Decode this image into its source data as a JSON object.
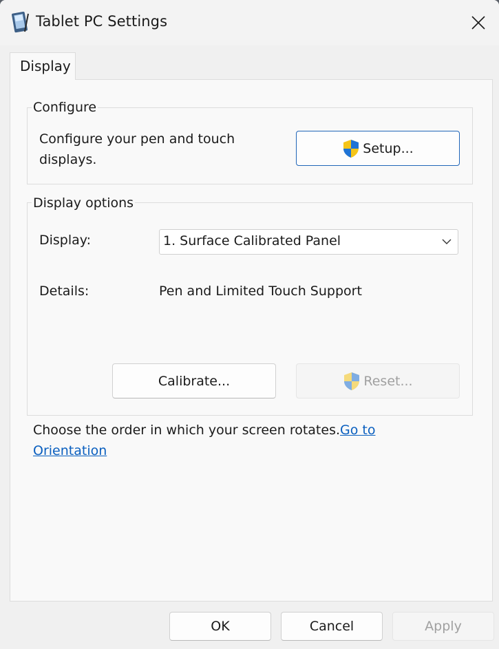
{
  "window": {
    "title": "Tablet PC Settings",
    "accent_color": "#1f65b8",
    "link_color": "#0a5fbf"
  },
  "icons": {
    "app": "tablet-pc-icon",
    "close": "close-icon",
    "shield": "uac-shield-icon",
    "dropdown": "chevron-down-icon"
  },
  "tabs": [
    {
      "label": "Display",
      "selected": true
    }
  ],
  "configure": {
    "group_title": "Configure",
    "description_line1": "Configure your pen and touch",
    "description_line2": "displays.",
    "setup_label": "Setup..."
  },
  "display_options": {
    "group_title": "Display options",
    "display_label": "Display:",
    "display_value": "1. Surface Calibrated Panel",
    "details_label": "Details:",
    "details_value": "Pen and Limited Touch Support",
    "calibrate_label": "Calibrate...",
    "reset_label": "Reset...",
    "reset_enabled": false
  },
  "orientation": {
    "text": "Choose the order in which your screen rotates.",
    "link_line1": "Go to",
    "link_line2": "Orientation"
  },
  "footer": {
    "ok_label": "OK",
    "cancel_label": "Cancel",
    "apply_label": "Apply",
    "apply_enabled": false
  }
}
